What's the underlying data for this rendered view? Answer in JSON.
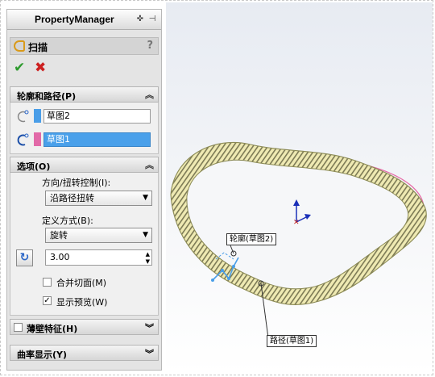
{
  "panel": {
    "title": "PropertyManager",
    "feature_title": "扫描",
    "help": "?",
    "ok_icon": "checkmark-icon",
    "cancel_icon": "cross-icon"
  },
  "profile_path": {
    "header": "轮廓和路径(P)",
    "profile_value": "草图2",
    "path_value": "草图1",
    "profile_color": "#4a9ee8",
    "path_color": "#e26aa8"
  },
  "options": {
    "header": "选项(O)",
    "orientation_label": "方向/扭转控制(I):",
    "orientation_value": "沿路径扭转",
    "define_label": "定义方式(B):",
    "define_value": "旋转",
    "twist_value": "3.00",
    "merge_tangent_label": "合并切面(M)",
    "merge_tangent_checked": false,
    "show_preview_label": "显示预览(W)",
    "show_preview_checked": true
  },
  "thin_feature": {
    "header": "薄壁特征(H)",
    "checked": false
  },
  "curvature": {
    "header": "曲率显示(Y)"
  },
  "viewport": {
    "profile_callout": "轮廓(草图2)",
    "path_callout": "路径(草图1)",
    "sweep_color": "#e8e3a0",
    "path_ellipse_color": "#e56aa6"
  }
}
